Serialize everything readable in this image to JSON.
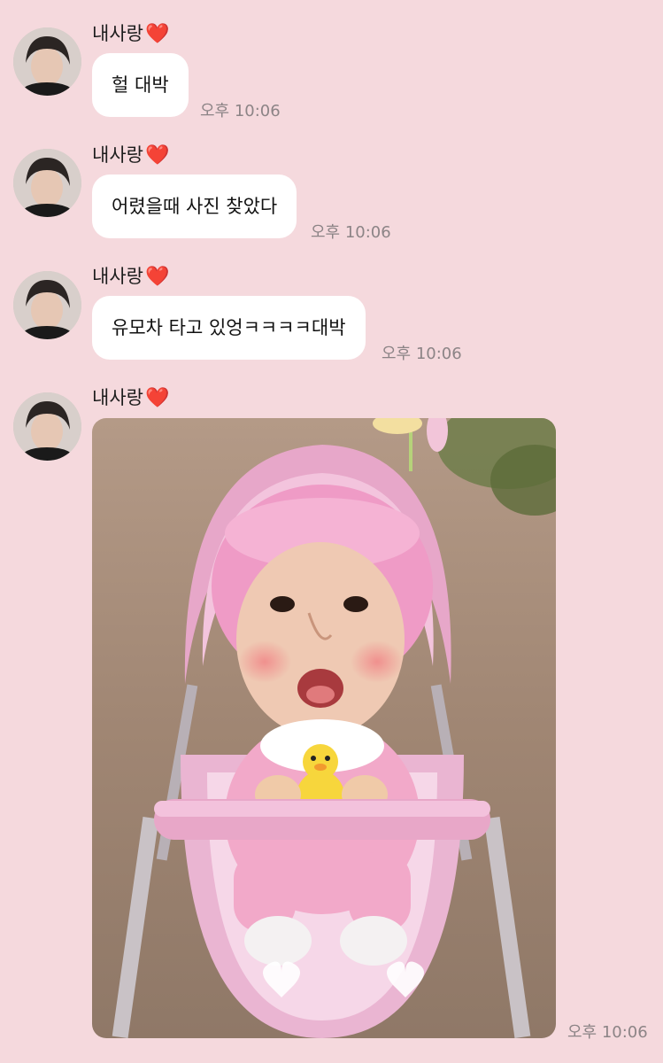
{
  "messages": [
    {
      "sender": "내사랑",
      "heart": "❤️",
      "text": "헐 대박",
      "time": "오후 10:06"
    },
    {
      "sender": "내사랑",
      "heart": "❤️",
      "text": "어렸을때 사진 찾았다",
      "time": "오후 10:06"
    },
    {
      "sender": "내사랑",
      "heart": "❤️",
      "text": "유모차 타고 있엉ㅋㅋㅋㅋ대박",
      "time": "오후 10:06"
    },
    {
      "sender": "내사랑",
      "heart": "❤️",
      "image": "baby-stroller-photo",
      "time": "오후 10:06"
    }
  ],
  "colors": {
    "background": "#f5d9dd",
    "bubble": "#ffffff",
    "time_text": "#8c8486",
    "heart": "#e0202e"
  }
}
